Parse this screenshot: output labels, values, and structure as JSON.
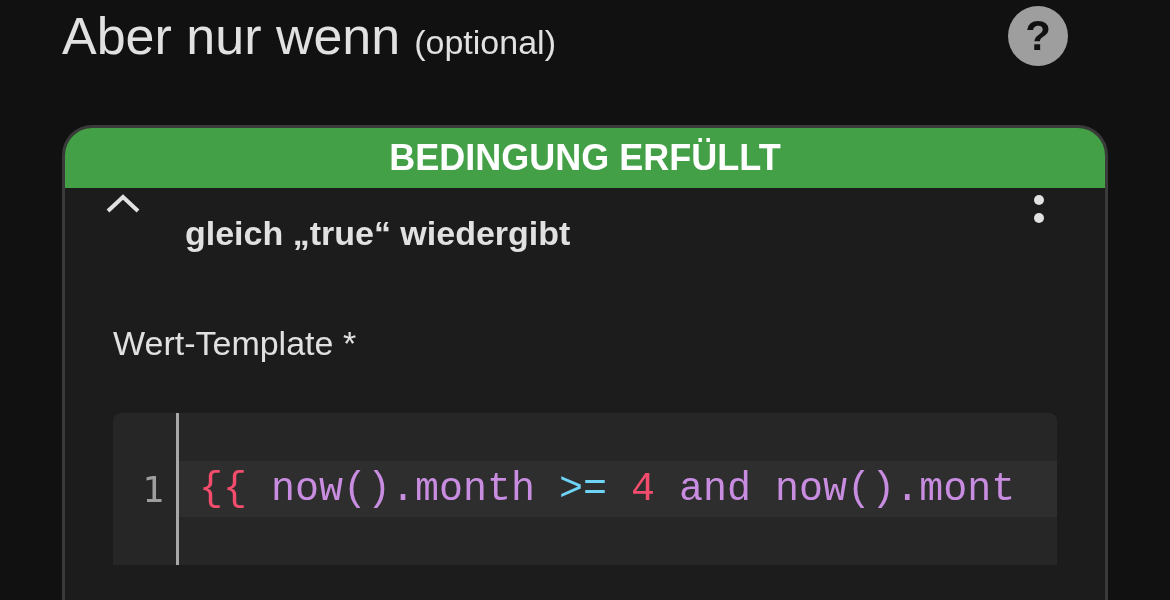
{
  "heading": {
    "title": "Aber nur wenn",
    "note": "(optional)"
  },
  "help_button": {
    "label": "?"
  },
  "condition_card": {
    "status": "BEDINGUNG ERFÜLLT",
    "expanded": true,
    "title": "gleich „true“ wiedergibt",
    "field_label": "Wert-Template *",
    "editor": {
      "lines": [
        {
          "number": "1",
          "tokens": [
            {
              "kind": "brace",
              "text": "{{"
            },
            {
              "kind": "ident",
              "text": "now().month"
            },
            {
              "kind": "operator",
              "text": ">="
            },
            {
              "kind": "number",
              "text": "4"
            },
            {
              "kind": "keyword",
              "text": "and"
            },
            {
              "kind": "ident",
              "text": "now().mont"
            }
          ]
        }
      ]
    }
  }
}
